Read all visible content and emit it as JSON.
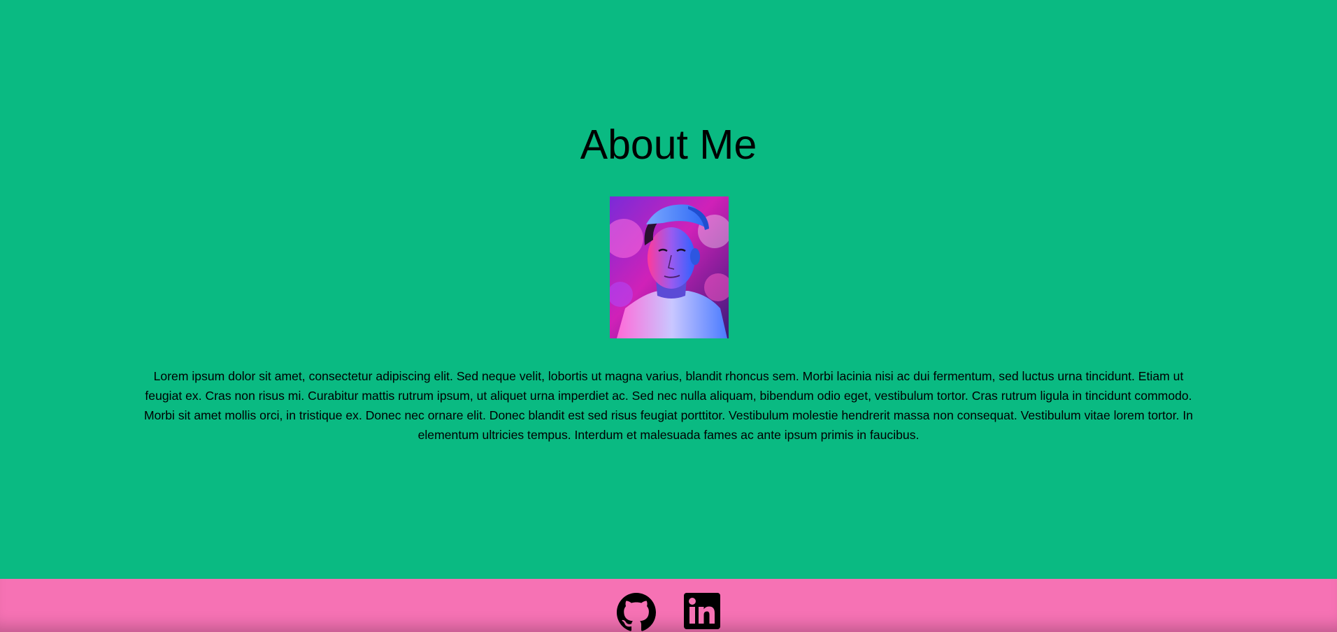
{
  "page": {
    "title": "About Me",
    "bio": "Lorem ipsum dolor sit amet, consectetur adipiscing elit. Sed neque velit, lobortis ut magna varius, blandit rhoncus sem. Morbi lacinia nisi ac dui fermentum, sed luctus urna tincidunt. Etiam ut feugiat ex. Cras non risus mi. Curabitur mattis rutrum ipsum, ut aliquet urna imperdiet ac. Sed nec nulla aliquam, bibendum odio eget, vestibulum tortor. Cras rutrum ligula in tincidunt commodo. Morbi sit amet mollis orci, in tristique ex. Donec nec ornare elit. Donec blandit est sed risus feugiat porttitor. Vestibulum molestie hendrerit massa non consequat. Vestibulum vitae lorem tortor. In elementum ultricies tempus. Interdum et malesuada fames ac ante ipsum primis in faucibus."
  },
  "footer": {
    "links": [
      {
        "icon": "github-icon"
      },
      {
        "icon": "linkedin-icon"
      }
    ]
  },
  "colors": {
    "background": "#0aba82",
    "footer": "#f672b4",
    "text": "#000000"
  }
}
